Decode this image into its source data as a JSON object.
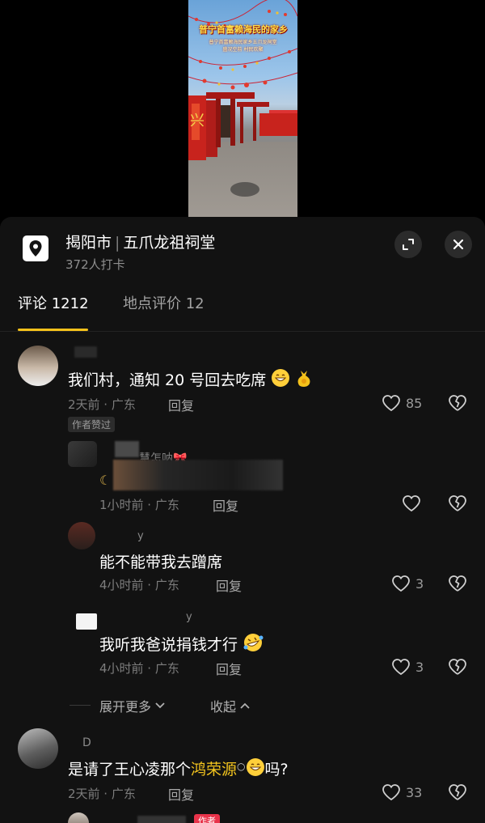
{
  "video": {
    "title": "普宁首富赖海民的家乡",
    "subtitle_lines": [
      "普宁首富赖海民家乡五爪龙祠堂",
      "盛况空前 村民欢聚"
    ]
  },
  "location": {
    "city": "揭阳市",
    "place": "五爪龙祖祠堂",
    "checkins": "372人打卡",
    "pin_icon": "location-pin-icon",
    "expand_icon": "expand-icon",
    "close_icon": "close-icon"
  },
  "tabs": {
    "comments": "评论 1212",
    "place_reviews": "地点评价 12"
  },
  "comments": [
    {
      "name": "",
      "text": "我们村，通知 20 号回去吃席",
      "meta": "2天前 · 广东",
      "reply": "回复",
      "likes": "85",
      "badge": "作者赞过"
    },
    {
      "name": "慧怎呐",
      "text": "",
      "meta": "1小时前 · 广东",
      "reply": "回复",
      "likes": ""
    },
    {
      "name": "y",
      "text": "能不能带我去蹭席",
      "meta": "4小时前 · 广东",
      "reply": "回复",
      "likes": "3"
    },
    {
      "name": "y",
      "text": "我听我爸说捐钱才行",
      "meta": "4小时前 · 广东",
      "reply": "回复",
      "likes": "3"
    },
    {
      "name": "D",
      "text_before": "是请了王心凌那个",
      "text_link": "鸿荣源",
      "text_after": "吗?",
      "meta": "2天前 · 广东",
      "reply": "回复",
      "likes": "33"
    }
  ],
  "thread": {
    "expand_more": "展开更多",
    "collapse": "收起"
  },
  "bottom_badge": "作者",
  "colors": {
    "accent": "#f5c21b",
    "background": "#121212",
    "text": "#ffffff",
    "muted": "#7d7d7d"
  }
}
